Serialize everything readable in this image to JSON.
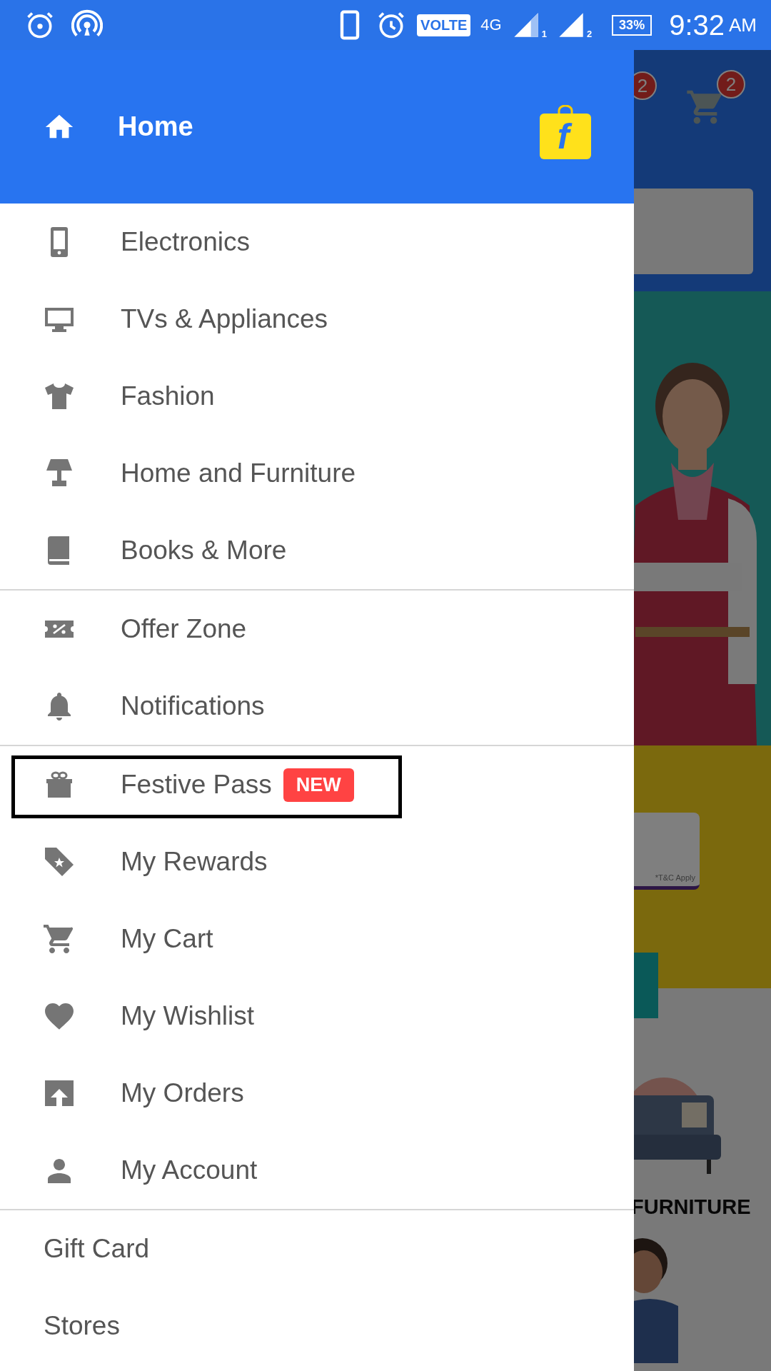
{
  "status_bar": {
    "volte": "VOLTE",
    "network": "4G",
    "sim_labels": [
      "1",
      "2"
    ],
    "battery": "33%",
    "time": "9:32",
    "meridiem": "AM"
  },
  "drawer": {
    "header": {
      "label": "Home",
      "logo_glyph": "f"
    },
    "sections": [
      {
        "items": [
          {
            "label": "Electronics",
            "kind": "phone",
            "highlighted": false
          },
          {
            "label": "TVs & Appliances",
            "kind": "monitor",
            "highlighted": false
          },
          {
            "label": "Fashion",
            "kind": "tshirt",
            "highlighted": false
          },
          {
            "label": "Home and Furniture",
            "kind": "lamp",
            "highlighted": false
          },
          {
            "label": "Books & More",
            "kind": "book",
            "highlighted": false
          }
        ]
      },
      {
        "items": [
          {
            "label": "Offer Zone",
            "kind": "ticket",
            "highlighted": false
          },
          {
            "label": "Notifications",
            "kind": "bell",
            "highlighted": false
          }
        ]
      },
      {
        "items": [
          {
            "label": "Festive Pass",
            "kind": "gift",
            "badge": "NEW",
            "highlighted": true
          },
          {
            "label": "My Rewards",
            "kind": "tag",
            "highlighted": false
          },
          {
            "label": "My Cart",
            "kind": "cart",
            "highlighted": false
          },
          {
            "label": "My Wishlist",
            "kind": "heart",
            "highlighted": false
          },
          {
            "label": "My Orders",
            "kind": "orders",
            "highlighted": false
          },
          {
            "label": "My Account",
            "kind": "person",
            "highlighted": false
          }
        ]
      },
      {
        "items": [
          {
            "label": "Gift Card",
            "kind": "plain",
            "highlighted": false
          },
          {
            "label": "Stores",
            "kind": "plain",
            "highlighted": false
          }
        ]
      }
    ]
  },
  "background": {
    "badges": [
      "2",
      "2"
    ],
    "card_note": "*T&C Apply",
    "category": "FURNITURE"
  }
}
